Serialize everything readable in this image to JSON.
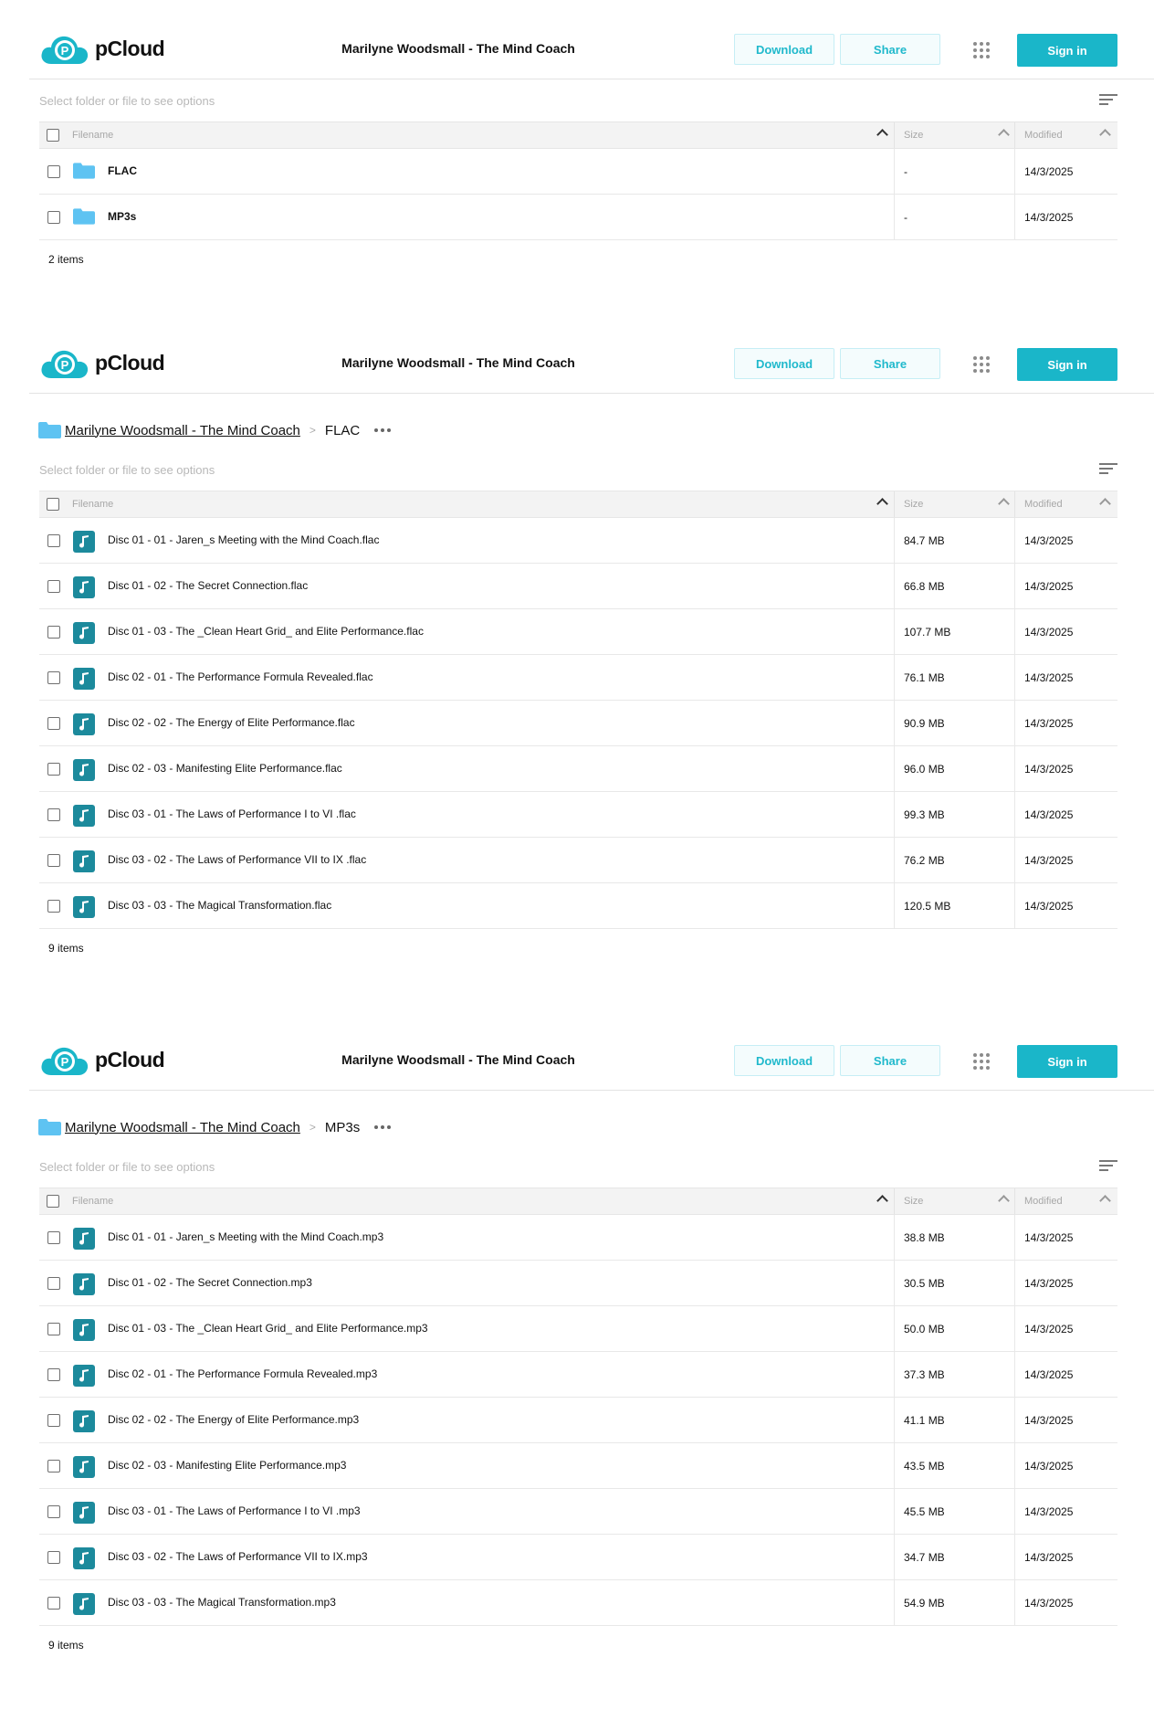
{
  "brand": {
    "name": "pCloud",
    "logo_letter": "P",
    "color": "#1ab6c9"
  },
  "header": {
    "title": "Marilyne Woodsmall - The Mind Coach",
    "download_label": "Download",
    "share_label": "Share",
    "signin_label": "Sign in",
    "apps_icon": "grid-icon"
  },
  "hint": "Select folder or file to see options",
  "columns": {
    "filename": "Filename",
    "size": "Size",
    "modified": "Modified"
  },
  "panels": [
    {
      "breadcrumb": null,
      "rows": [
        {
          "type": "folder",
          "name": "FLAC",
          "size": "-",
          "modified": "14/3/2025"
        },
        {
          "type": "folder",
          "name": "MP3s",
          "size": "-",
          "modified": "14/3/2025"
        }
      ],
      "count": "2 items"
    },
    {
      "breadcrumb": {
        "root": "Marilyne Woodsmall - The Mind Coach",
        "current": "FLAC"
      },
      "rows": [
        {
          "type": "audio",
          "name": "Disc 01 - 01 - Jaren_s Meeting with the Mind Coach.flac",
          "size": "84.7 MB",
          "modified": "14/3/2025"
        },
        {
          "type": "audio",
          "name": "Disc 01 - 02 - The Secret Connection.flac",
          "size": "66.8 MB",
          "modified": "14/3/2025"
        },
        {
          "type": "audio",
          "name": "Disc 01 - 03 - The _Clean Heart Grid_ and Elite Performance.flac",
          "size": "107.7 MB",
          "modified": "14/3/2025"
        },
        {
          "type": "audio",
          "name": "Disc 02 - 01 - The Performance Formula Revealed.flac",
          "size": "76.1 MB",
          "modified": "14/3/2025"
        },
        {
          "type": "audio",
          "name": "Disc 02 - 02 - The Energy of Elite Performance.flac",
          "size": "90.9 MB",
          "modified": "14/3/2025"
        },
        {
          "type": "audio",
          "name": "Disc 02 - 03 - Manifesting Elite Performance.flac",
          "size": "96.0 MB",
          "modified": "14/3/2025"
        },
        {
          "type": "audio",
          "name": "Disc 03 - 01 - The Laws of Performance I to VI .flac",
          "size": "99.3 MB",
          "modified": "14/3/2025"
        },
        {
          "type": "audio",
          "name": "Disc 03 - 02 - The Laws of Performance VII to IX .flac",
          "size": "76.2 MB",
          "modified": "14/3/2025"
        },
        {
          "type": "audio",
          "name": "Disc 03 - 03 - The Magical Transformation.flac",
          "size": "120.5 MB",
          "modified": "14/3/2025"
        }
      ],
      "count": "9 items"
    },
    {
      "breadcrumb": {
        "root": "Marilyne Woodsmall - The Mind Coach",
        "current": "MP3s"
      },
      "rows": [
        {
          "type": "audio",
          "name": "Disc 01 - 01 - Jaren_s Meeting with the Mind Coach.mp3",
          "size": "38.8 MB",
          "modified": "14/3/2025"
        },
        {
          "type": "audio",
          "name": "Disc 01 - 02 - The Secret Connection.mp3",
          "size": "30.5 MB",
          "modified": "14/3/2025"
        },
        {
          "type": "audio",
          "name": "Disc 01 - 03 - The _Clean Heart Grid_ and Elite Performance.mp3",
          "size": "50.0 MB",
          "modified": "14/3/2025"
        },
        {
          "type": "audio",
          "name": "Disc 02 - 01 - The Performance Formula Revealed.mp3",
          "size": "37.3 MB",
          "modified": "14/3/2025"
        },
        {
          "type": "audio",
          "name": "Disc 02 - 02 - The Energy of Elite Performance.mp3",
          "size": "41.1 MB",
          "modified": "14/3/2025"
        },
        {
          "type": "audio",
          "name": "Disc 02 - 03 - Manifesting Elite Performance.mp3",
          "size": "43.5 MB",
          "modified": "14/3/2025"
        },
        {
          "type": "audio",
          "name": "Disc 03 - 01 - The Laws of Performance I to VI .mp3",
          "size": "45.5 MB",
          "modified": "14/3/2025"
        },
        {
          "type": "audio",
          "name": "Disc 03 - 02 - The Laws of Performance VII to IX.mp3",
          "size": "34.7 MB",
          "modified": "14/3/2025"
        },
        {
          "type": "audio",
          "name": "Disc 03 - 03 - The Magical Transformation.mp3",
          "size": "54.9 MB",
          "modified": "14/3/2025"
        }
      ],
      "count": "9 items"
    }
  ]
}
